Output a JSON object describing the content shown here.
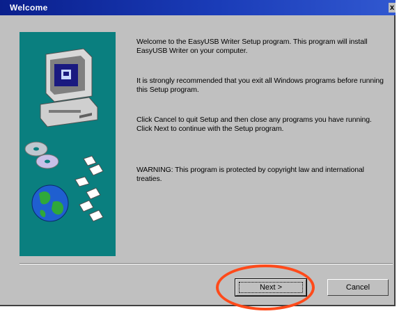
{
  "window": {
    "title": "Welcome",
    "close_glyph": "x"
  },
  "content": {
    "paragraphs": [
      "Welcome to the EasyUSB Writer Setup program. This program will install EasyUSB Writer on your computer.",
      "It is strongly recommended that you exit all Windows programs before running this Setup program.",
      "Click Cancel to quit Setup and then close any programs you have running. Click Next to continue with the Setup program.",
      "WARNING: This program is protected by copyright law and international treaties."
    ]
  },
  "buttons": {
    "next": "Next >",
    "cancel": "Cancel"
  },
  "colors": {
    "titlebar": "#0a1f8c",
    "side_panel": "#0a7f7f",
    "highlight": "#ff4a1a"
  },
  "icons": {
    "computer": "computer-icon",
    "cd": "cd-icon",
    "globe": "globe-icon",
    "documents": "document-icon"
  }
}
